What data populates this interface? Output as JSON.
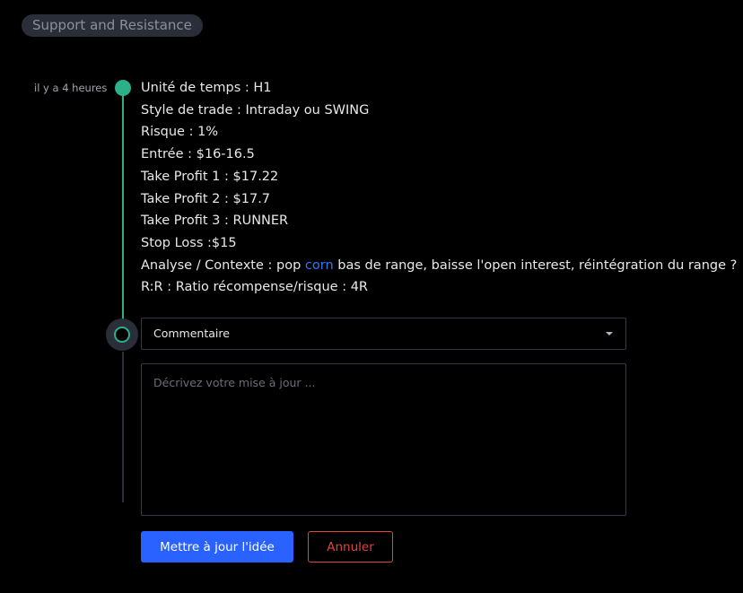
{
  "header": {
    "tag_label": "Support and Resistance"
  },
  "timeline": {
    "timestamp": "il y a 4 heures",
    "accent_color": "#2bb08a",
    "update": {
      "lines": {
        "timeframe": "Unité de temps : H1",
        "style": "Style de trade : Intraday ou SWING",
        "risk": "Risque : 1%",
        "entry": "Entrée : $16-16.5",
        "tp1": "Take Profit 1 : $17.22",
        "tp2": "Take Profit 2 : $17.7",
        "tp3": "Take Profit 3 : RUNNER",
        "stop_loss": "Stop Loss :$15",
        "analysis_prefix": "Analyse / Contexte : pop ",
        "analysis_link": "corn",
        "analysis_suffix": " bas de range, baisse l'open interest, réintégration du range ?",
        "rr": "R:R : Ratio récompense/risque : 4R"
      }
    }
  },
  "form": {
    "type_select": {
      "value": "Commentaire",
      "icon": "caret-down-icon"
    },
    "description": {
      "placeholder": "Décrivez votre mise à jour ...",
      "value": ""
    },
    "submit_label": "Mettre à jour l'idée",
    "cancel_label": "Annuler"
  },
  "colors": {
    "primary": "#2962ff",
    "danger": "#e0463a",
    "link": "#3179f5"
  }
}
